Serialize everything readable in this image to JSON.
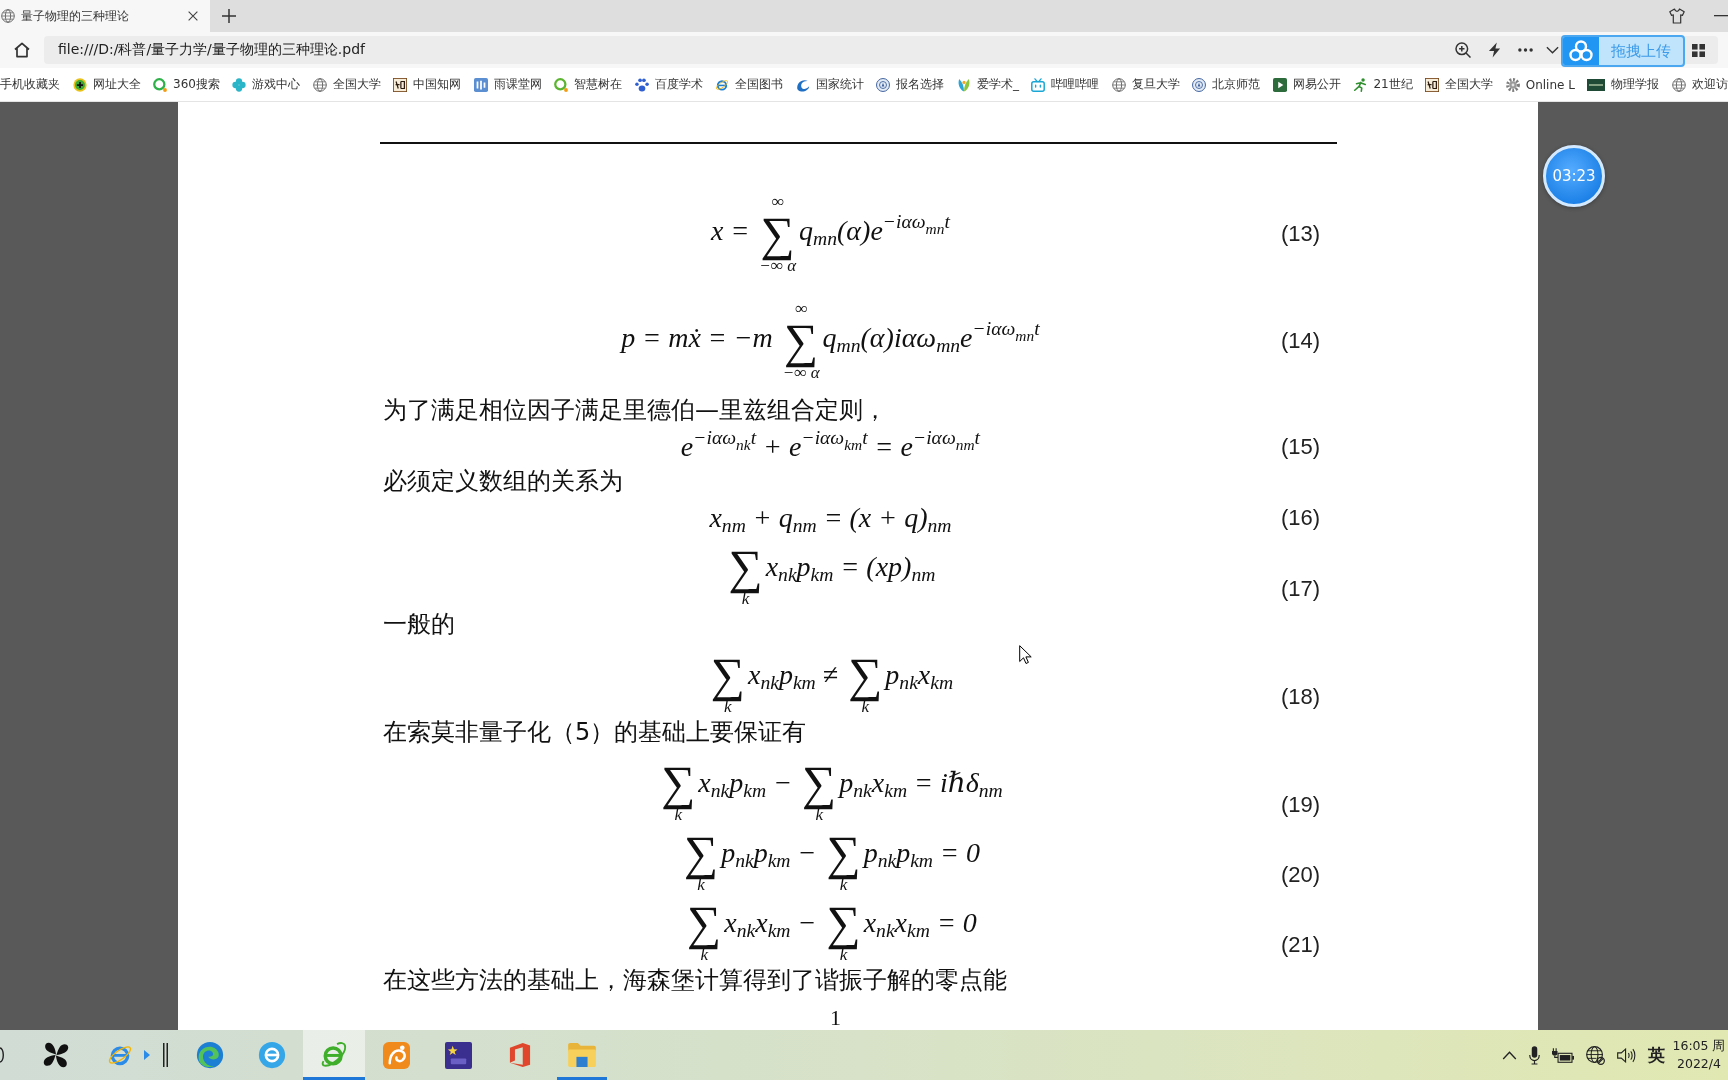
{
  "browser": {
    "tab": {
      "title": "量子物理的三种理论",
      "selected": true
    },
    "address": {
      "value": "file:///D:/科普/量子力学/量子物理的三种理论.pdf"
    },
    "upload_button": {
      "label": "拖拽上传"
    },
    "bookmarks": [
      {
        "label": "手机收藏夹"
      },
      {
        "label": "网址大全"
      },
      {
        "label": "360搜索"
      },
      {
        "label": "游戏中心"
      },
      {
        "label": "全国大学"
      },
      {
        "label": "中国知网"
      },
      {
        "label": "雨课堂网"
      },
      {
        "label": "智慧树在"
      },
      {
        "label": "百度学术"
      },
      {
        "label": "全国图书"
      },
      {
        "label": "国家统计"
      },
      {
        "label": "报名选择"
      },
      {
        "label": "爱学术_"
      },
      {
        "label": "哔哩哔哩"
      },
      {
        "label": "复旦大学"
      },
      {
        "label": "北京师范"
      },
      {
        "label": "网易公开"
      },
      {
        "label": "21世纪"
      },
      {
        "label": "全国大学"
      },
      {
        "label": "Online L"
      },
      {
        "label": "物理学报"
      },
      {
        "label": "欢迎访"
      }
    ]
  },
  "document": {
    "blocks": [
      {
        "kind": "equation",
        "number": "(13)",
        "parts": [
          {
            "kind": "math",
            "text": "x = "
          },
          {
            "kind": "sum",
            "symbol": "∑",
            "over": "∞",
            "under": "−∞ α"
          },
          {
            "kind": "math",
            "text": "q$_{mn}$(α)e$^{−iαω}$$_{mn}$$^{t}$"
          }
        ]
      },
      {
        "kind": "equation",
        "number": "(14)",
        "parts": [
          {
            "kind": "math",
            "text": "p = mẋ = −m "
          },
          {
            "kind": "sum",
            "symbol": "∑",
            "over": "∞",
            "under": "−∞ α"
          },
          {
            "kind": "math",
            "text": "q$_{mn}$(α)iαω$_{mn}$e$^{−iαω}$$_{mn}$$^{t}$"
          }
        ]
      },
      {
        "kind": "text",
        "text": "为了满足相位因子满足里德伯—里兹组合定则，"
      },
      {
        "kind": "equation",
        "number": "(15)",
        "parts": [
          {
            "kind": "math",
            "text": "e$^{−iαω}$$_{nk}$$^{t}$ + e$^{−iαω}$$_{km}$$^{t}$ = e$^{−iαω}$$_{nm}$$^{t}$"
          }
        ]
      },
      {
        "kind": "text",
        "text": "必须定义数组的关系为"
      },
      {
        "kind": "equation",
        "number": "(16)",
        "parts": [
          {
            "kind": "math",
            "text": "x$_{nm}$ + q$_{nm}$ = (x + q)$_{nm}$"
          }
        ]
      },
      {
        "kind": "equation",
        "number": "(17)",
        "parts": [
          {
            "kind": "sum",
            "symbol": "∑",
            "under": "k"
          },
          {
            "kind": "math",
            "text": "x$_{nk}$p$_{km}$ = (xp)$_{nm}$"
          }
        ]
      },
      {
        "kind": "text",
        "text": "一般的"
      },
      {
        "kind": "equation",
        "number": "(18)",
        "parts": [
          {
            "kind": "sum",
            "symbol": "∑",
            "under": "k"
          },
          {
            "kind": "math",
            "text": "x$_{nk}$p$_{km}$ ≠ "
          },
          {
            "kind": "sum",
            "symbol": "∑",
            "under": "k"
          },
          {
            "kind": "math",
            "text": "p$_{nk}$x$_{km}$"
          }
        ]
      },
      {
        "kind": "text",
        "text": "在索莫非量子化（5）的基础上要保证有"
      },
      {
        "kind": "equation",
        "number": "(19)",
        "parts": [
          {
            "kind": "sum",
            "symbol": "∑",
            "under": "k"
          },
          {
            "kind": "math",
            "text": "x$_{nk}$p$_{km}$ − "
          },
          {
            "kind": "sum",
            "symbol": "∑",
            "under": "k"
          },
          {
            "kind": "math",
            "text": "p$_{nk}$x$_{km}$ = iℏδ$_{nm}$"
          }
        ]
      },
      {
        "kind": "equation",
        "number": "(20)",
        "parts": [
          {
            "kind": "sum",
            "symbol": "∑",
            "under": "k"
          },
          {
            "kind": "math",
            "text": "p$_{nk}$p$_{km}$ − "
          },
          {
            "kind": "sum",
            "symbol": "∑",
            "under": "k"
          },
          {
            "kind": "math",
            "text": "p$_{nk}$p$_{km}$ = 0"
          }
        ]
      },
      {
        "kind": "equation",
        "number": "(21)",
        "parts": [
          {
            "kind": "sum",
            "symbol": "∑",
            "under": "k"
          },
          {
            "kind": "math",
            "text": "x$_{nk}$x$_{km}$ − "
          },
          {
            "kind": "sum",
            "symbol": "∑",
            "under": "k"
          },
          {
            "kind": "math",
            "text": "x$_{nk}$x$_{km}$ = 0"
          }
        ]
      },
      {
        "kind": "text",
        "text": "在这些方法的基础上，海森堡计算得到了谐振子解的零点能"
      }
    ],
    "page_number": "1"
  },
  "timer": {
    "time": "03:23"
  },
  "taskbar": {
    "apps": [
      {
        "selected": false,
        "running": false
      },
      {
        "selected": false,
        "running": false
      },
      {
        "selected": false,
        "running": false
      },
      {
        "selected": false,
        "running": false
      },
      {
        "selected": true,
        "running": true
      },
      {
        "selected": false,
        "running": false
      },
      {
        "selected": false,
        "running": false
      },
      {
        "selected": false,
        "running": false
      },
      {
        "selected": false,
        "running": true
      }
    ],
    "input_method": "英",
    "clock": {
      "time": "16:05 周",
      "date": "2022/4"
    }
  }
}
